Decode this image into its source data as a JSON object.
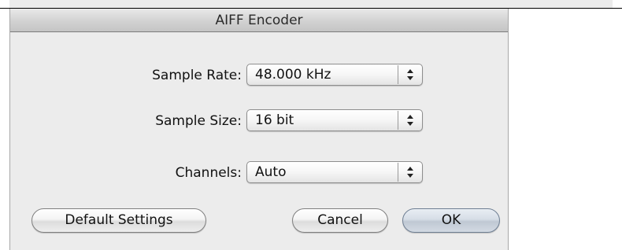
{
  "window": {
    "title": "AIFF Encoder"
  },
  "form": {
    "sample_rate": {
      "label": "Sample Rate:",
      "value": "48.000 kHz"
    },
    "sample_size": {
      "label": "Sample Size:",
      "value": "16 bit"
    },
    "channels": {
      "label": "Channels:",
      "value": "Auto"
    }
  },
  "buttons": {
    "default_settings": "Default Settings",
    "cancel": "Cancel",
    "ok": "OK"
  },
  "icons": {
    "popup_arrows": "up-down-arrows-icon"
  }
}
